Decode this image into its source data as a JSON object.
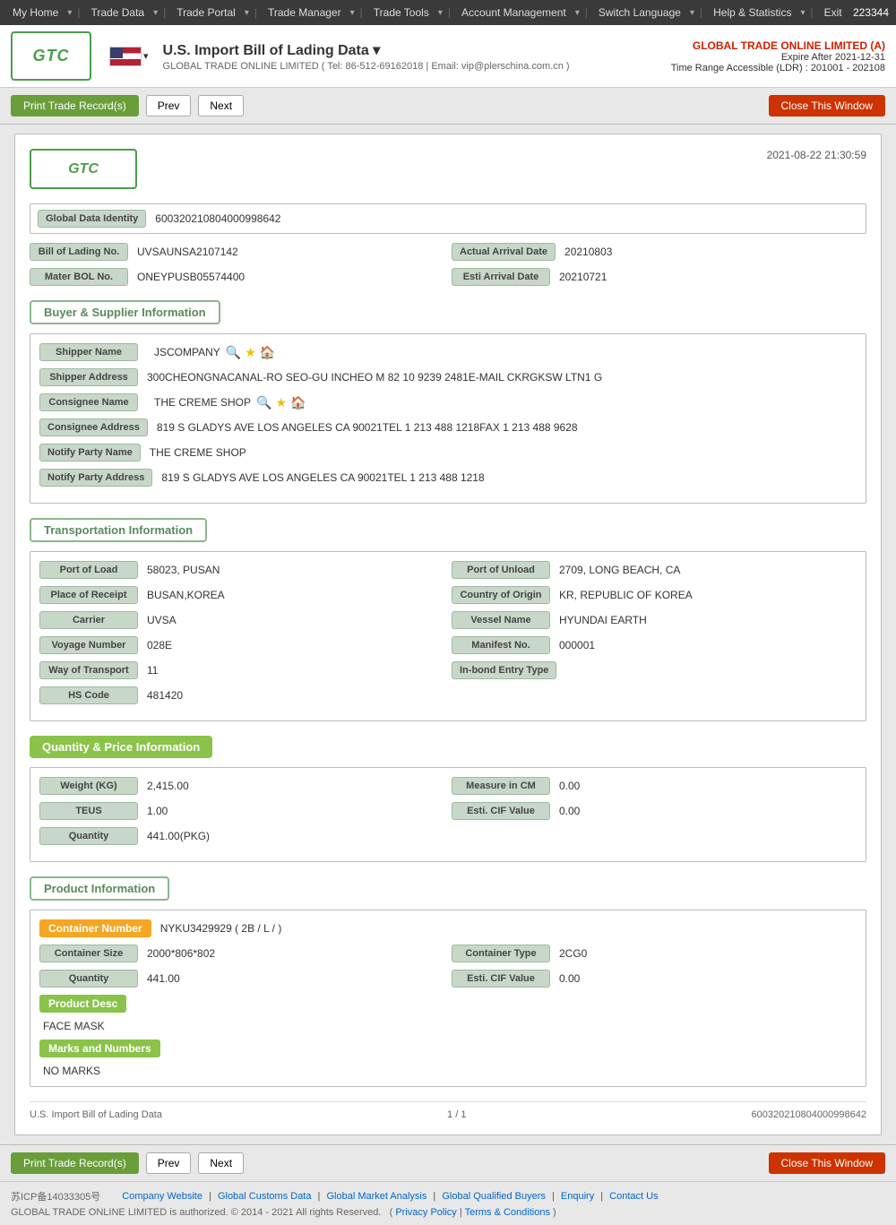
{
  "topnav": {
    "user_id": "223344",
    "items": [
      {
        "label": "My Home",
        "arrow": true
      },
      {
        "label": "Trade Data",
        "arrow": true
      },
      {
        "label": "Trade Portal",
        "arrow": true
      },
      {
        "label": "Trade Manager",
        "arrow": true
      },
      {
        "label": "Trade Tools",
        "arrow": true
      },
      {
        "label": "Account Management",
        "arrow": true
      },
      {
        "label": "Switch Language",
        "arrow": true
      },
      {
        "label": "Help & Statistics",
        "arrow": true
      },
      {
        "label": "Exit",
        "arrow": false
      }
    ]
  },
  "header": {
    "logo_text": "GTC",
    "page_title": "U.S. Import Bill of Lading Data",
    "page_title_arrow": "▾",
    "subtitle": "GLOBAL TRADE ONLINE LIMITED ( Tel: 86-512-69162018 | Email: vip@plerschina.com.cn )",
    "company_name": "GLOBAL TRADE ONLINE LIMITED (A)",
    "expire_label": "Expire After 2021-12-31",
    "time_range": "Time Range Accessible (LDR) : 201001 - 202108"
  },
  "toolbar": {
    "print_label": "Print Trade Record(s)",
    "prev_label": "Prev",
    "next_label": "Next",
    "close_label": "Close This Window"
  },
  "record": {
    "timestamp": "2021-08-22 21:30:59",
    "global_data_id_label": "Global Data Identity",
    "global_data_id_value": "600320210804000998642",
    "bol_no_label": "Bill of Lading No.",
    "bol_no_value": "UVSAUNSA2107142",
    "actual_arrival_label": "Actual Arrival Date",
    "actual_arrival_value": "20210803",
    "mater_bol_label": "Mater BOL No.",
    "mater_bol_value": "ONEYPUSB05574400",
    "esti_arrival_label": "Esti Arrival Date",
    "esti_arrival_value": "20210721",
    "sections": {
      "buyer_supplier": {
        "title": "Buyer & Supplier Information",
        "shipper_name_label": "Shipper Name",
        "shipper_name_value": "JSCOMPANY",
        "shipper_address_label": "Shipper Address",
        "shipper_address_value": "300CHEONGNACANAL-RO SEO-GU INCHEO M 82 10 9239 2481E-MAIL CKRGKSW LTN1 G",
        "consignee_name_label": "Consignee Name",
        "consignee_name_value": "THE CREME SHOP",
        "consignee_address_label": "Consignee Address",
        "consignee_address_value": "819 S GLADYS AVE LOS ANGELES CA 90021TEL 1 213 488 1218FAX 1 213 488 9628",
        "notify_party_name_label": "Notify Party Name",
        "notify_party_name_value": "THE CREME SHOP",
        "notify_party_address_label": "Notify Party Address",
        "notify_party_address_value": "819 S GLADYS AVE LOS ANGELES CA 90021TEL 1 213 488 1218"
      },
      "transportation": {
        "title": "Transportation Information",
        "port_of_load_label": "Port of Load",
        "port_of_load_value": "58023, PUSAN",
        "port_of_unload_label": "Port of Unload",
        "port_of_unload_value": "2709, LONG BEACH,  CA",
        "place_of_receipt_label": "Place of Receipt",
        "place_of_receipt_value": "BUSAN,KOREA",
        "country_of_origin_label": "Country of Origin",
        "country_of_origin_value": "KR, REPUBLIC OF KOREA",
        "carrier_label": "Carrier",
        "carrier_value": "UVSA",
        "vessel_name_label": "Vessel Name",
        "vessel_name_value": "HYUNDAI EARTH",
        "voyage_number_label": "Voyage Number",
        "voyage_number_value": "028E",
        "manifest_no_label": "Manifest No.",
        "manifest_no_value": "000001",
        "way_of_transport_label": "Way of Transport",
        "way_of_transport_value": "11",
        "in_bond_label": "In-bond Entry Type",
        "in_bond_value": "",
        "hs_code_label": "HS Code",
        "hs_code_value": "481420"
      },
      "quantity_price": {
        "title": "Quantity & Price Information",
        "weight_label": "Weight (KG)",
        "weight_value": "2,415.00",
        "measure_cm_label": "Measure in CM",
        "measure_cm_value": "0.00",
        "teus_label": "TEUS",
        "teus_value": "1.00",
        "esti_cif_label": "Esti. CIF Value",
        "esti_cif_value": "0.00",
        "quantity_label": "Quantity",
        "quantity_value": "441.00(PKG)"
      },
      "product": {
        "title": "Product Information",
        "container_number_label": "Container Number",
        "container_number_value": "NYKU3429929 ( 2B / L /  )",
        "container_size_label": "Container Size",
        "container_size_value": "2000*806*802",
        "container_type_label": "Container Type",
        "container_type_value": "2CG0",
        "quantity_label": "Quantity",
        "quantity_value": "441.00",
        "esti_cif_label": "Esti. CIF Value",
        "esti_cif_value": "0.00",
        "product_desc_label": "Product Desc",
        "product_desc_value": "FACE MASK",
        "marks_label": "Marks and Numbers",
        "marks_value": "NO MARKS"
      }
    },
    "footer": {
      "record_title": "U.S. Import Bill of Lading Data",
      "page_info": "1 / 1",
      "record_id": "600320210804000998642"
    }
  },
  "bottom_toolbar": {
    "print_label": "Print Trade Record(s)",
    "prev_label": "Prev",
    "next_label": "Next",
    "close_label": "Close This Window"
  },
  "page_footer": {
    "icp": "苏ICP备14033305号",
    "links": [
      "Company Website",
      "Global Customs Data",
      "Global Market Analysis",
      "Global Qualified Buyers",
      "Enquiry",
      "Contact Us"
    ],
    "copyright": "GLOBAL TRADE ONLINE LIMITED is authorized. © 2014 - 2021 All rights Reserved.",
    "privacy_label": "Privacy Policy",
    "terms_label": "Terms & Conditions"
  }
}
